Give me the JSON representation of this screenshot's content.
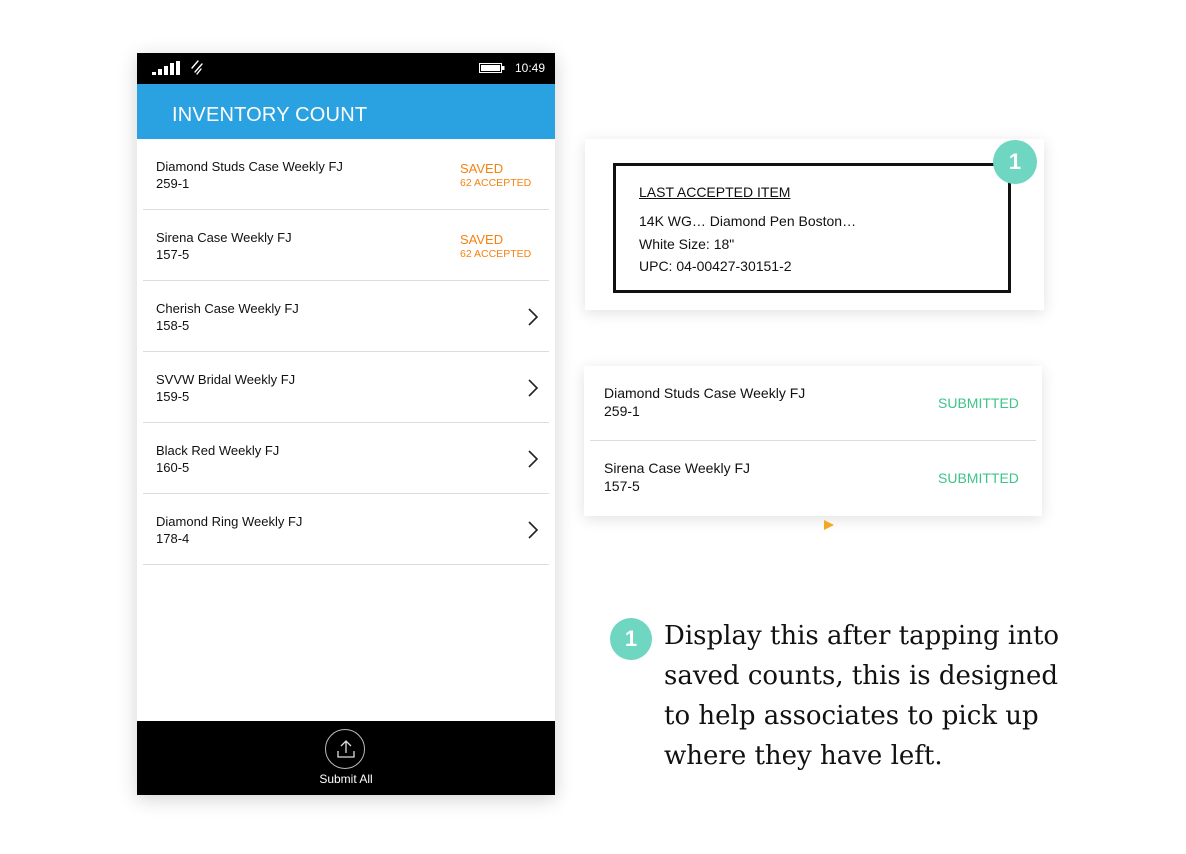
{
  "status_bar": {
    "time": "10:49"
  },
  "header": {
    "title": "INVENTORY COUNT"
  },
  "counts": [
    {
      "name": "Diamond Studs Case Weekly FJ",
      "code": "259-1",
      "status": "SAVED",
      "accepted": "62 ACCEPTED"
    },
    {
      "name": "Sirena Case Weekly FJ",
      "code": "157-5",
      "status": "SAVED",
      "accepted": "62 ACCEPTED"
    },
    {
      "name": "Cherish Case Weekly FJ",
      "code": "158-5"
    },
    {
      "name": "SVVW Bridal Weekly FJ",
      "code": "159-5"
    },
    {
      "name": "Black Red Weekly FJ",
      "code": "160-5"
    },
    {
      "name": "Diamond Ring Weekly FJ",
      "code": "178-4"
    }
  ],
  "footer": {
    "submit_label": "Submit All",
    "icon": "upload-icon"
  },
  "last_accepted": {
    "title": "LAST ACCEPTED ITEM",
    "item": "14K WG… Diamond Pen Boston…",
    "size": "White Size: 18\"",
    "upc": "UPC: 04-00427-30151-2",
    "badge": "1"
  },
  "submitted": [
    {
      "name": "Diamond Studs Case Weekly FJ",
      "code": "259-1",
      "status": "SUBMITTED"
    },
    {
      "name": "Sirena Case Weekly FJ",
      "code": "157-5",
      "status": "SUBMITTED"
    }
  ],
  "note": {
    "badge": "1",
    "lines": [
      "Display this after tapping into",
      "saved counts, this is designed",
      "to help associates to pick up",
      "where they have left."
    ]
  },
  "colors": {
    "header_blue": "#2aa1e0",
    "saved_orange": "#f5820f",
    "submitted_green": "#3ec48a",
    "badge_teal": "#6fd6c2",
    "pointer_orange": "#f5a623"
  }
}
